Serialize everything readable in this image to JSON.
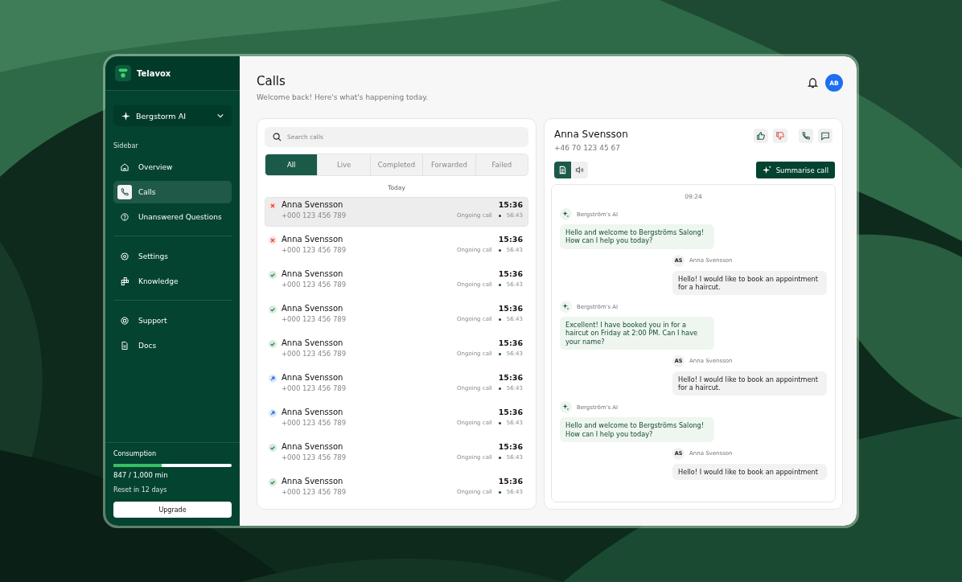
{
  "sidebar": {
    "brand": "Telavox",
    "workspace": "Bergstorm AI",
    "section_label": "Sidebar",
    "groups": [
      [
        {
          "label": "Overview",
          "selected": false
        },
        {
          "label": "Calls",
          "selected": true
        },
        {
          "label": "Unanswered Questions",
          "selected": false
        }
      ],
      [
        {
          "label": "Settings",
          "selected": false
        },
        {
          "label": "Knowledge",
          "selected": false
        }
      ],
      [
        {
          "label": "Support",
          "selected": false
        },
        {
          "label": "Docs",
          "selected": false
        }
      ]
    ],
    "consumption": {
      "label": "Consumption",
      "level": 0.41,
      "reading": "847 / 1,000 min",
      "reset": "Reset in 12 days"
    },
    "upgrade_button": "Upgrade"
  },
  "header": {
    "title": "Calls",
    "subtitle": "Welcome back! Here's what's happening today.",
    "avatar": "AB"
  },
  "calls": {
    "search": {
      "placeholder": "Search calls"
    },
    "tabs": [
      {
        "label": "All",
        "selected": true
      },
      {
        "label": "Live",
        "selected": false
      },
      {
        "label": "Completed",
        "selected": false
      },
      {
        "label": "Forwarded",
        "selected": false
      },
      {
        "label": "Failed",
        "selected": false
      }
    ],
    "group_label": "Today",
    "rows": [
      {
        "kind": "failed",
        "name": "Anna Svensson",
        "phone": "+000 123 456 789",
        "time": "15:36",
        "status": "Ongoing call",
        "duration": "56:43",
        "selected": true
      },
      {
        "kind": "failed",
        "name": "Anna Svensson",
        "phone": "+000 123 456 789",
        "time": "15:36",
        "status": "Ongoing call",
        "duration": "56:43",
        "selected": false
      },
      {
        "kind": "completed",
        "name": "Anna Svensson",
        "phone": "+000 123 456 789",
        "time": "15:36",
        "status": "Ongoing call",
        "duration": "56:43",
        "selected": false
      },
      {
        "kind": "completed",
        "name": "Anna Svensson",
        "phone": "+000 123 456 789",
        "time": "15:36",
        "status": "Ongoing call",
        "duration": "56:43",
        "selected": false
      },
      {
        "kind": "completed",
        "name": "Anna Svensson",
        "phone": "+000 123 456 789",
        "time": "15:36",
        "status": "Ongoing call",
        "duration": "56:43",
        "selected": false
      },
      {
        "kind": "forwarded",
        "name": "Anna Svensson",
        "phone": "+000 123 456 789",
        "time": "15:36",
        "status": "Ongoing call",
        "duration": "56:43",
        "selected": false
      },
      {
        "kind": "forwarded",
        "name": "Anna Svensson",
        "phone": "+000 123 456 789",
        "time": "15:36",
        "status": "Ongoing call",
        "duration": "56:43",
        "selected": false
      },
      {
        "kind": "completed",
        "name": "Anna Svensson",
        "phone": "+000 123 456 789",
        "time": "15:36",
        "status": "Ongoing call",
        "duration": "56:43",
        "selected": false
      },
      {
        "kind": "completed",
        "name": "Anna Svensson",
        "phone": "+000 123 456 789",
        "time": "15:36",
        "status": "Ongoing call",
        "duration": "56:43",
        "selected": false
      }
    ]
  },
  "detail": {
    "name": "Anna Svensson",
    "phone": "+46 70 123 45 67",
    "view_toggle": [
      {
        "kind": "transcript",
        "selected": true
      },
      {
        "kind": "audio",
        "selected": false
      }
    ],
    "summarise_button": "Summarise call",
    "transcript": {
      "time": "09:24",
      "messages": [
        {
          "kind": "ai",
          "author": "Bergström's AI",
          "text": "Hello and welcome to Bergströms Salong! How can I help you today?"
        },
        {
          "kind": "user",
          "initials": "AS",
          "author": "Anna Svensson",
          "text": "Hello! I would like to book an appointment for a haircut."
        },
        {
          "kind": "ai",
          "author": "Bergström's AI",
          "text": "Excellent! I have booked you in for a haircut on Friday at 2:00 PM. Can I have your name?"
        },
        {
          "kind": "user",
          "initials": "AS",
          "author": "Anna Svensson",
          "text": "Hello! I would like to book an appointment for a haircut."
        },
        {
          "kind": "ai",
          "author": "Bergström's AI",
          "text": "Hello and welcome to Bergströms Salong! How can I help you today?"
        },
        {
          "kind": "user",
          "initials": "AS",
          "author": "Anna Svensson",
          "text": "Hello! I would like to book an appointment"
        }
      ]
    }
  }
}
